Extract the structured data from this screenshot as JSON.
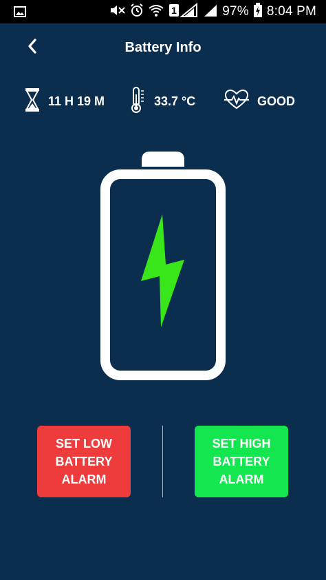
{
  "status_bar": {
    "battery_percent": "97%",
    "time": "8:04 PM",
    "sim_label": "1",
    "icons": [
      "image-notification-icon",
      "mute-icon",
      "alarm-icon",
      "wifi-icon",
      "sim1-signal-icon",
      "signal-icon",
      "battery-charging-icon"
    ]
  },
  "header": {
    "title": "Battery Info",
    "back_icon": "chevron-left-icon"
  },
  "info": {
    "time_remaining": "11 H 19 M",
    "temperature": "33.7 °C",
    "health": "GOOD",
    "icons": [
      "hourglass-icon",
      "thermometer-icon",
      "heart-pulse-icon"
    ]
  },
  "battery_graphic": {
    "icon": "battery-charging-icon",
    "bolt_color": "#39e619",
    "outline_color": "#ffffff"
  },
  "buttons": {
    "low_alarm": "SET LOW BATTERY ALARM",
    "high_alarm": "SET HIGH BATTERY ALARM"
  },
  "colors": {
    "background": "#0b2d4e",
    "low_button": "#ee3b3c",
    "high_button": "#14e650"
  }
}
